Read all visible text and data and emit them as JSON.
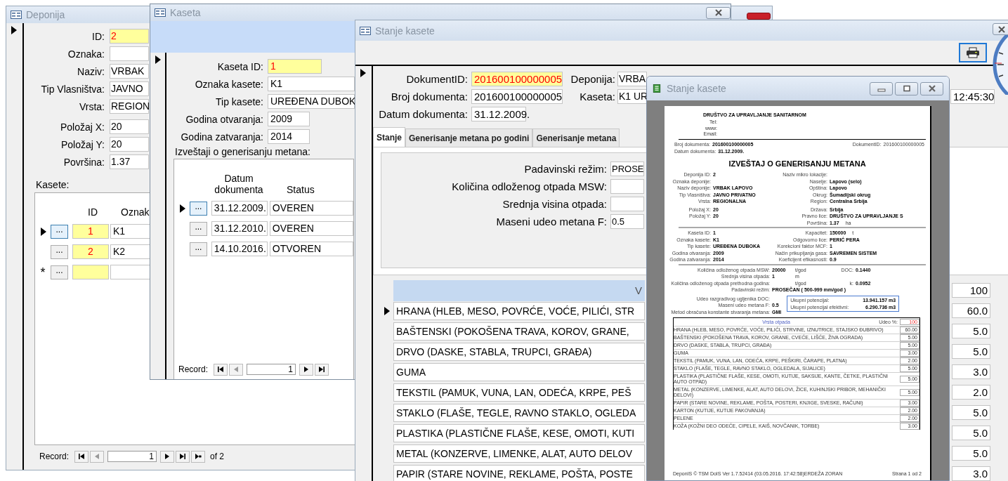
{
  "deponija": {
    "title": "Deponija",
    "fields": [
      {
        "label": "ID:",
        "value": "2",
        "kind": "key"
      },
      {
        "label": "Oznaka:",
        "kind": "text"
      },
      {
        "label": "Naziv:",
        "value": "VRBAK",
        "kind": "text"
      },
      {
        "label": "Tip Vlasništva:",
        "value": "JAVNO",
        "kind": "text"
      },
      {
        "label": "Vrsta:",
        "value": "REGION",
        "kind": "text"
      },
      {
        "label": "Položaj X:",
        "value": "20",
        "kind": "text"
      },
      {
        "label": "Položaj Y:",
        "value": "20",
        "kind": "text"
      },
      {
        "label": "Površina:",
        "value": "1.37",
        "kind": "text"
      }
    ],
    "subform": {
      "label": "Kasete:",
      "columns": [
        "ID",
        "Oznak"
      ],
      "rows": [
        {
          "button": "...",
          "id": "1",
          "code": "K1",
          "selected": true
        },
        {
          "button": "...",
          "id": "2",
          "code": "K2",
          "selected": false
        }
      ],
      "new_row": {
        "marker": "*",
        "button": "..."
      }
    },
    "record_nav": {
      "label": "Record:",
      "current": "1",
      "total": "of 2"
    }
  },
  "kaseta": {
    "title": "Kaseta",
    "fields": [
      {
        "label": "Kaseta ID:",
        "value": "1",
        "kind": "key"
      },
      {
        "label": "Oznaka kasete:",
        "value": "K1",
        "kind": "text"
      },
      {
        "label": "Tip kasete:",
        "value": "UREĐENA DUBOK",
        "kind": "text"
      },
      {
        "label": "Godina otvaranja:",
        "value": "2009",
        "kind": "short"
      },
      {
        "label": "Godina zatvaranja:",
        "value": "2014",
        "kind": "short"
      }
    ],
    "reports": {
      "label": "Izveštaji o generisanju metana:",
      "columns": [
        "Datum dokumenta",
        "Status"
      ],
      "rows": [
        {
          "button": "...",
          "date": "31.12.2009.",
          "status": "OVEREN",
          "selected": true
        },
        {
          "button": "...",
          "date": "31.12.2010.",
          "status": "OVEREN",
          "selected": false
        },
        {
          "button": "...",
          "date": "14.10.2016.",
          "status": "OTVOREN",
          "selected": false
        }
      ]
    },
    "record_nav": {
      "label": "Record:",
      "current": "1"
    }
  },
  "stanje": {
    "title": "Stanje kasete",
    "top_rows": [
      {
        "label": "DokumentID:",
        "value": "201600100000005",
        "kind": "key",
        "link_label": "Deponija:",
        "link_value": "VRBA"
      },
      {
        "label": "Broj dokumenta:",
        "value": "201600100000005",
        "kind": "text",
        "link_label": "Kaseta:",
        "link_value": "K1 UR",
        "aside": "12:45:30"
      },
      {
        "label": "Datum dokumenta:",
        "value": "31.12.2009.",
        "kind": "short"
      }
    ],
    "tabs": [
      {
        "label": "Stanje",
        "selected": true
      },
      {
        "label": "Generisanje metana po godini",
        "selected": false
      },
      {
        "label": "Generisanje metana",
        "selected": false
      }
    ],
    "panel_fields": [
      {
        "label": "Padavinski režim:",
        "value": "PROSE"
      },
      {
        "label": "Količina odloženog otpada MSW:"
      },
      {
        "label": "Srednja visina otpada:"
      },
      {
        "label": "Maseni udeo metana F:",
        "value": "0.5"
      }
    ],
    "waste_table": {
      "header": "V",
      "total": "100",
      "rows": [
        {
          "name": "HRANA (HLEB, MESO, POVRĆE, VOĆE, PILIĆI, STR",
          "value": "60.0",
          "selected": true
        },
        {
          "name": "BAŠTENSKI (POKOŠENA TRAVA, KOROV, GRANE,",
          "value": "5.0",
          "selected": false
        },
        {
          "name": "DRVO (DASKE, STABLA, TRUPCI, GRAĐA)",
          "value": "5.0",
          "selected": false
        },
        {
          "name": "GUMA",
          "value": "3.0",
          "selected": false
        },
        {
          "name": "TEKSTIL (PAMUK, VUNA, LAN, ODEĆA, KRPE, PEŠ",
          "value": "2.0",
          "selected": false
        },
        {
          "name": "STAKLO (FLAŠE, TEGLE, RAVNO STAKLO, OGLEDA",
          "value": "5.0",
          "selected": false
        },
        {
          "name": "PLASTIKA (PLASTIČNE FLAŠE, KESE, OMOTI, KUTI",
          "value": "5.0",
          "selected": false
        },
        {
          "name": "METAL (KONZERVE, LIMENKE, ALAT, AUTO DELOV",
          "value": "5.0",
          "selected": false
        },
        {
          "name": "PAPIR (STARE NOVINE, REKLAME, POŠTA, POSTE",
          "value": "3.0",
          "selected": false
        }
      ]
    }
  },
  "preview": {
    "title": "Stanje kasete",
    "report": {
      "company": "DRUŠTVO ZA UPRAVLJANJE SANITARNOM",
      "contacts": [
        "Tel:",
        "www:",
        "Email:"
      ],
      "doc_number": {
        "label": "Broj dokumenta:",
        "value": "201600100000005"
      },
      "doc_id": {
        "label": "DokumentID:",
        "value": "201600100000005"
      },
      "doc_date": {
        "label": "Datum dokumenta:",
        "value": "31.12.2009."
      },
      "heading": "IZVEŠTAJ O GENERISANJU METANA",
      "sections": [
        {
          "left": [
            {
              "label": "Deponija ID:",
              "value": "2"
            },
            {
              "label": "Oznaka deponije:"
            },
            {
              "label": "Naziv deponije:",
              "value": "VRBAK LAPOVO"
            },
            {
              "label": "Tip Vlasništva:",
              "value": "JAVNO PRIVATNO"
            },
            {
              "label": "Vrsta:",
              "value": "REGIONALNA"
            },
            {
              "label": "Položaj X:",
              "value": "20"
            },
            {
              "label": "Položaj Y:",
              "value": "20"
            }
          ],
          "right": [
            {
              "label": "Naziv mikro lokacije:"
            },
            {
              "label": "Naselje:",
              "value": "Lapovo (selo)"
            },
            {
              "label": "Opština:",
              "value": "Lapovo"
            },
            {
              "label": "Okrug:",
              "value": "Šumadijski okrug"
            },
            {
              "label": "Region:",
              "value": "Centralna Srbija"
            },
            {
              "label": "Država:",
              "value": "Srbija"
            },
            {
              "label": "Pravno lice:",
              "value": "DRUŠTVO ZA UPRAVLJANJE S"
            },
            {
              "label": "Površina:",
              "value": "1.37",
              "unit": "ha"
            }
          ]
        },
        {
          "left": [
            {
              "label": "Kaseta ID:",
              "value": "1"
            },
            {
              "label": "Oznaka kasete:",
              "value": "K1"
            },
            {
              "label": "Tip kasete:",
              "value": "UREĐENA DUBOKA"
            },
            {
              "label": "Godina otvaranja:",
              "value": "2009"
            },
            {
              "label": "Godina zatvaranja:",
              "value": "2014"
            }
          ],
          "right": [
            {
              "label": "Kapacitet:",
              "value": "150000",
              "unit": "t"
            },
            {
              "label": "Odgovorno lice:",
              "value": "PERIĆ PERA"
            },
            {
              "label": "Korekcioni faktor MCF:",
              "value": "1"
            },
            {
              "label": "Način prikupljanja gasa:",
              "value": "SAVREMEN SISTEM"
            },
            {
              "label": "Koeficijent efikasnosti:",
              "value": "0.9"
            }
          ]
        }
      ],
      "quantities": [
        {
          "label": "Količina odloženog otpada MSW:",
          "value": "20000",
          "unit": "t/god",
          "extra_label": "DOC:",
          "extra_value": "0.1440"
        },
        {
          "label": "Srednja visina otpada:",
          "value": "1",
          "unit": "m"
        },
        {
          "label": "Količina odloženog otpada prethodna godina:",
          "unit": "t/god",
          "extra_label": "k:",
          "extra_value": "0.0952"
        },
        {
          "label": "Padavinski režim:",
          "value": "PROSEČAN ( 500-999 mm/god )"
        }
      ],
      "factors": [
        {
          "label": "Udeo razgradivog ugljenika DOC:"
        },
        {
          "label": "Maseni udeo metana F:",
          "value": "0.5"
        },
        {
          "label": "Metod obračuna konstante stvaranja metana:",
          "value": "GMI"
        }
      ],
      "potentials": [
        {
          "label": "Ukupni potencijal:",
          "value": "13.941.157 m3"
        },
        {
          "label": "Ukupni potencijal efektivni:",
          "value": "6.290.736 m3"
        }
      ],
      "waste_table": {
        "header": "Vrsta otpada",
        "total_label": "Udeo %:",
        "total": "100",
        "rows": [
          {
            "name": "HRANA (HLEB, MESO, POVRĆE, VOĆE, PILIĆI, STRVINE, IZNUTRICE, STAJSKO ĐUBRIVO)",
            "value": "60.00"
          },
          {
            "name": "BAŠTENSKI (POKOŠENA TRAVA, KOROV, GRANE, CVEĆE, LIŠĆE, ŽIVA OGRADA)",
            "value": "5.00"
          },
          {
            "name": "DRVO (DASKE, STABLA, TRUPCI, GRAĐA)",
            "value": "5.00"
          },
          {
            "name": "GUMA",
            "value": "3.00"
          },
          {
            "name": "TEKSTIL (PAMUK, VUNA, LAN, ODEĆA, KRPE, PEŠKIRI, ČARAPE, PLATNA)",
            "value": "2.00"
          },
          {
            "name": "STAKLO (FLAŠE, TEGLE, RAVNO STAKLO, OGLEDALA, SIJALICE)",
            "value": "5.00"
          },
          {
            "name": "PLASTIKA (PLASTIČNE FLAŠE, KESE, OMOTI, KUTIJE, SAKSIJE, KANTE, ČETKE, PLASTIČNI AUTO OTPAD)",
            "value": "5.00"
          },
          {
            "name": "METAL (KONZERVE, LIMENKE, ALAT, AUTO DELOVI, ŽICE, KUHINJSKI PRIBOR, MEHANIČKI DELOVI)",
            "value": "5.00"
          },
          {
            "name": "PAPIR (STARE NOVINE, REKLAME, POŠTA, POSTERI, KNJIGE, SVESKE, RAČUNI)",
            "value": "3.00"
          },
          {
            "name": "KARTON (KUTIJE, KUTIJE PAKOVANJA)",
            "value": "2.00"
          },
          {
            "name": "PELENE",
            "value": "2.00"
          },
          {
            "name": "KOŽA (KOŽNI DEO ODEĆE, CIPELE, KAIŠ, NOVČANIK, TORBE)",
            "value": "3.00"
          }
        ]
      },
      "footer": "DeponIS © TSM DoIS Ver 1.7.52414 (03.05.2016. 17:42:58)ERDEŽA ZORAN",
      "page": "Strana 1 od 2"
    }
  }
}
